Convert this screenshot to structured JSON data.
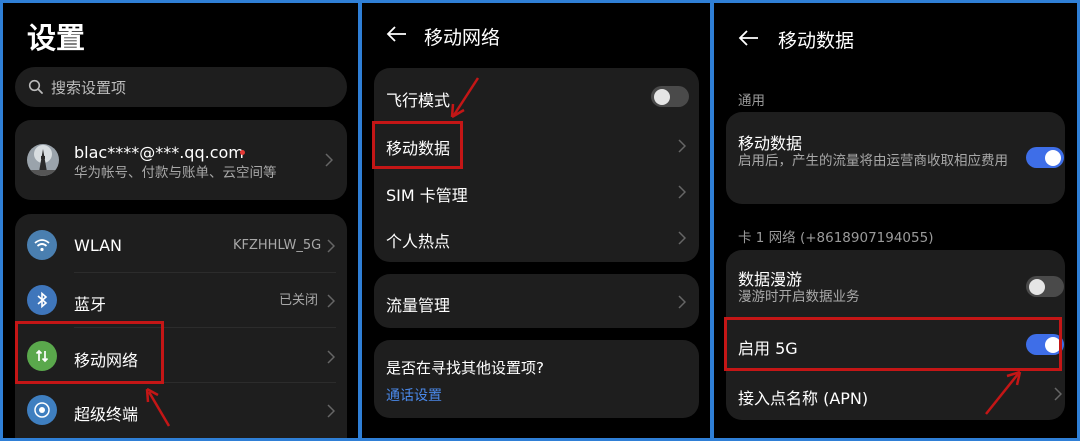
{
  "settings": {
    "title": "设置",
    "search_placeholder": "搜索设置项",
    "account": {
      "email": "blac****@***.qq.com",
      "desc": "华为帐号、付款与账单、云空间等"
    },
    "items": [
      {
        "label": "WLAN",
        "value": "KFZHHLW_5G",
        "icon": "wifi-icon",
        "color": "#4a7fb0"
      },
      {
        "label": "蓝牙",
        "value": "已关闭",
        "icon": "bluetooth-icon",
        "color": "#3f76bb"
      },
      {
        "label": "移动网络",
        "value": "",
        "icon": "mobile-data-icon",
        "color": "#5aa84c"
      },
      {
        "label": "超级终端",
        "value": "",
        "icon": "super-device-icon",
        "color": "#3f7fc0"
      }
    ]
  },
  "mobile_network": {
    "title": "移动网络",
    "airplane_label": "飞行模式",
    "airplane_on": false,
    "mobile_data_label": "移动数据",
    "sim_label": "SIM 卡管理",
    "hotspot_label": "个人热点",
    "traffic_label": "流量管理",
    "search_more_prompt": "是否在寻找其他设置项?",
    "call_settings_link": "通话设置"
  },
  "mobile_data": {
    "title": "移动数据",
    "section_general": "通用",
    "data_label": "移动数据",
    "data_desc": "启用后，产生的流量将由运营商收取相应费用",
    "data_on": true,
    "section_card1": "卡 1 网络 (+8618907194055)",
    "roaming_label": "数据漫游",
    "roaming_desc": "漫游时开启数据业务",
    "roaming_on": false,
    "enable5g_label": "启用 5G",
    "enable5g_on": true,
    "apn_label": "接入点名称 (APN)"
  },
  "colors": {
    "highlight": "#c41616",
    "accent": "#3e6ee8",
    "link": "#4a88e8",
    "frame": "#2f7fd6"
  }
}
